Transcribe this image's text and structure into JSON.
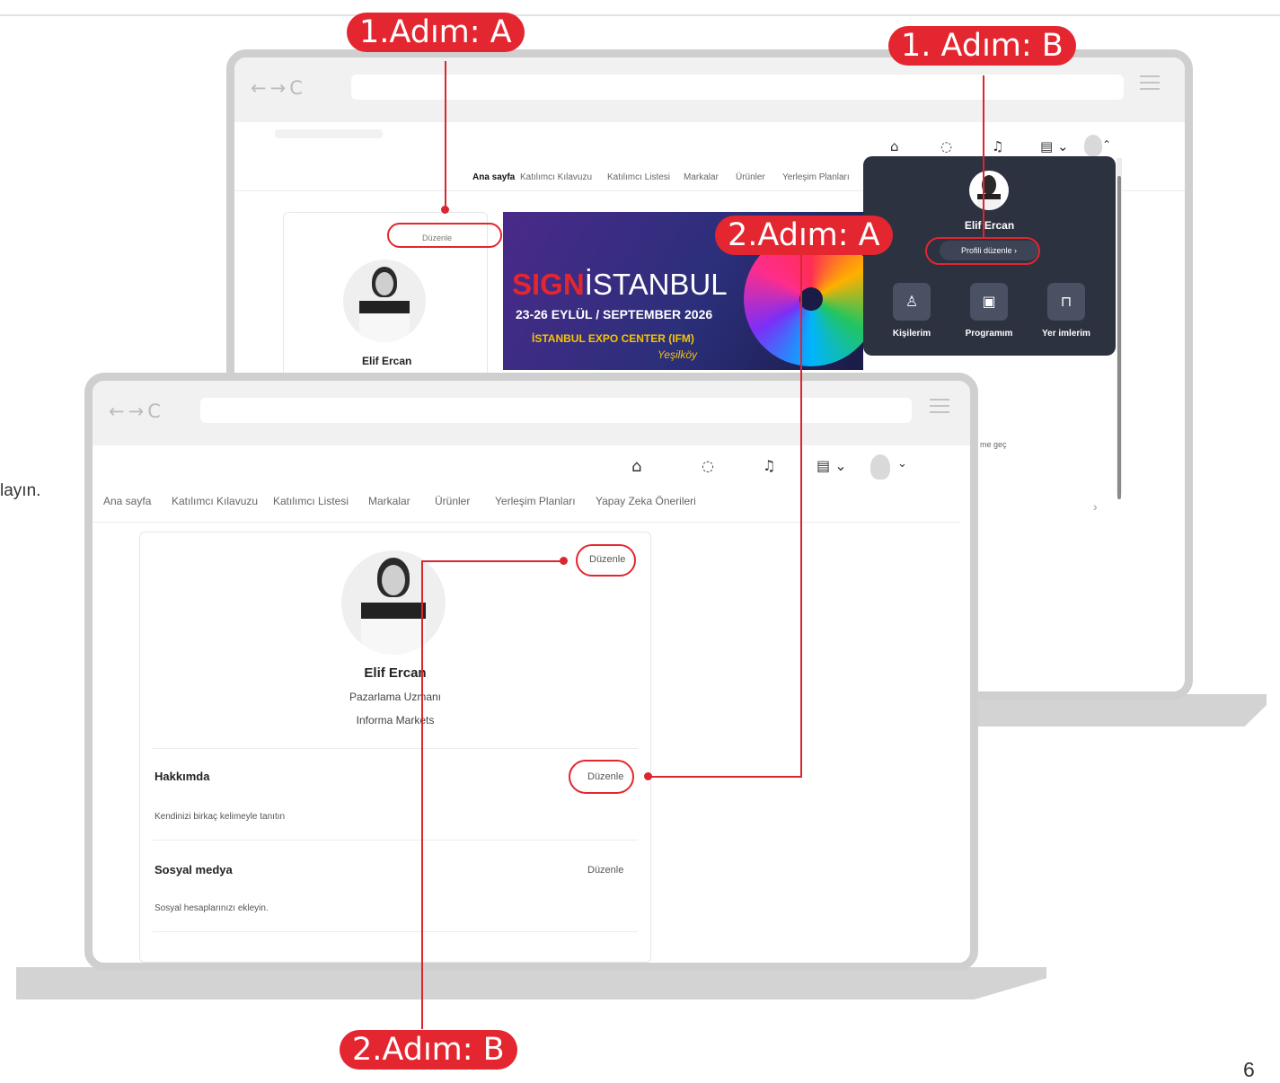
{
  "side_text": "layın.",
  "page_number": "6",
  "steps": {
    "step1a": "1.Adım: A",
    "step1b": "1. Adım: B",
    "step2a": "2.Adım: A",
    "step2b": "2.Adım: B"
  },
  "colors": {
    "accent_red": "#e3262f",
    "panel_dark": "#2c3240",
    "frame_gray": "#cfcfcf"
  },
  "icons": {
    "home": "home-icon",
    "chat": "chat-icon",
    "bell": "bell-icon",
    "building": "building-icon",
    "people": "people-icon",
    "calendar": "calendar-check-icon",
    "bookmark": "bookmark-icon"
  },
  "back_screen": {
    "nav": [
      "Ana sayfa",
      "Katılımcı Kılavuzu",
      "Katılımcı Listesi",
      "Markalar",
      "Ürünler",
      "Yerleşim Planları"
    ],
    "edit_label": "Düzenle",
    "profile_name": "Elif Ercan",
    "side_fragment": "me geç",
    "banner": {
      "title_red": "SIGN",
      "title_white": "İSTANBUL",
      "dates": "23-26 EYLÜL / SEPTEMBER 2026",
      "venue": "İSTANBUL EXPO CENTER (IFM)",
      "district": "Yeşilköy"
    },
    "dropdown": {
      "name": "Elif Ercan",
      "edit_profile": "Profili düzenle",
      "shortcuts": [
        "Kişilerim",
        "Programım",
        "Yer imlerim"
      ]
    }
  },
  "front_screen": {
    "nav": [
      "Ana sayfa",
      "Katılımcı Kılavuzu",
      "Katılımcı Listesi",
      "Markalar",
      "Ürünler",
      "Yerleşim Planları",
      "Yapay Zeka Önerileri"
    ],
    "profile": {
      "edit_label": "Düzenle",
      "name": "Elif Ercan",
      "title": "Pazarlama Uzmanı",
      "company": "Informa Markets"
    },
    "about": {
      "heading": "Hakkımda",
      "edit_label": "Düzenle",
      "placeholder": "Kendinizi birkaç kelimeyle tanıtın"
    },
    "social": {
      "heading": "Sosyal medya",
      "edit_label": "Düzenle",
      "placeholder": "Sosyal hesaplarınızı ekleyin."
    }
  }
}
